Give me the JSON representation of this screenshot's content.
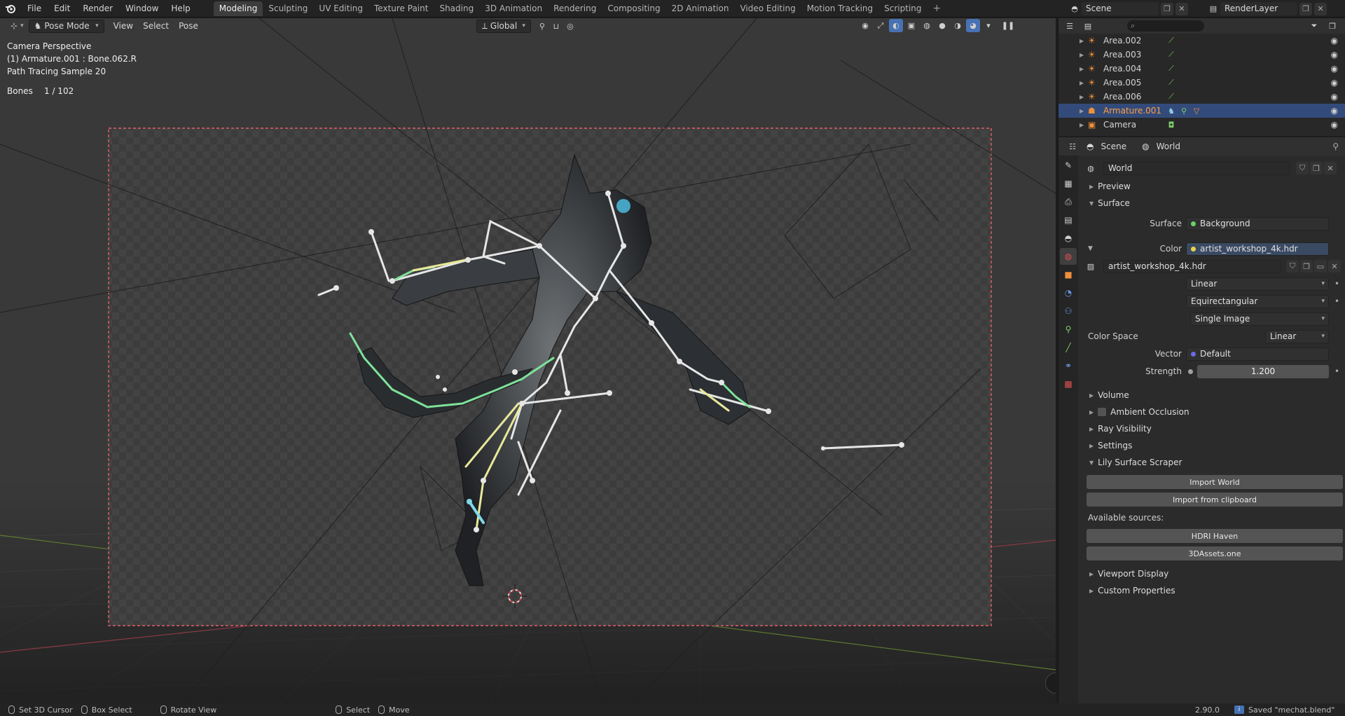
{
  "topbar": {
    "menus": [
      "File",
      "Edit",
      "Render",
      "Window",
      "Help"
    ],
    "workspaces": [
      "Modeling",
      "Sculpting",
      "UV Editing",
      "Texture Paint",
      "Shading",
      "3D Animation",
      "Rendering",
      "Compositing",
      "2D Animation",
      "Video Editing",
      "Motion Tracking",
      "Scripting"
    ],
    "active_workspace": "Modeling",
    "add_tab": "+",
    "scene": "Scene",
    "view_layer": "RenderLayer"
  },
  "viewport": {
    "mode": "Pose Mode",
    "menus": [
      "View",
      "Select",
      "Pose"
    ],
    "transform_orientation": "Global",
    "overlay": {
      "line1": "Camera Perspective",
      "line2": "(1) Armature.001 : Bone.062.R",
      "line3": "Path Tracing Sample 20",
      "bones_label": "Bones",
      "bones_value": "1 / 102"
    }
  },
  "statusbar": {
    "items": [
      "Set 3D Cursor",
      "Box Select",
      "Rotate View",
      "Select",
      "Move"
    ],
    "version": "2.90.0",
    "saved": "Saved \"mechat.blend\""
  },
  "outliner": {
    "items": [
      {
        "name": "Area.002",
        "selected": false
      },
      {
        "name": "Area.003",
        "selected": false
      },
      {
        "name": "Area.004",
        "selected": false
      },
      {
        "name": "Area.005",
        "selected": false
      },
      {
        "name": "Area.006",
        "selected": false
      },
      {
        "name": "Armature.001",
        "selected": true
      },
      {
        "name": "Camera",
        "selected": false
      }
    ]
  },
  "properties": {
    "breadcrumb_scene": "Scene",
    "breadcrumb_world": "World",
    "world_name": "World",
    "panels": {
      "preview": "Preview",
      "surface": "Surface",
      "volume": "Volume",
      "ambient_occlusion": "Ambient Occlusion",
      "ray_visibility": "Ray Visibility",
      "settings": "Settings",
      "lily": "Lily Surface Scraper",
      "viewport_display": "Viewport Display",
      "custom_properties": "Custom Properties"
    },
    "surface_label": "Surface",
    "surface_value": "Background",
    "color_label": "Color",
    "color_value": "artist_workshop_4k.hdr",
    "image_name": "artist_workshop_4k.hdr",
    "interpolation": "Linear",
    "projection": "Equirectangular",
    "source": "Single Image",
    "color_space_label": "Color Space",
    "color_space_value": "Linear",
    "vector_label": "Vector",
    "vector_value": "Default",
    "strength_label": "Strength",
    "strength_value": "1.200",
    "import_world": "Import World",
    "import_clipboard": "Import from clipboard",
    "available_sources": "Available sources:",
    "source_1": "HDRI Haven",
    "source_2": "3DAssets.one"
  },
  "colors": {
    "accent_blue": "#4772b3",
    "selected_row": "#334b7a",
    "object_orange": "#f0903c",
    "camera_frame": "#e0606a",
    "bone_white": "#e6e6e6",
    "bone_green": "#7ee29a",
    "bone_yellow": "#e8e89a"
  }
}
